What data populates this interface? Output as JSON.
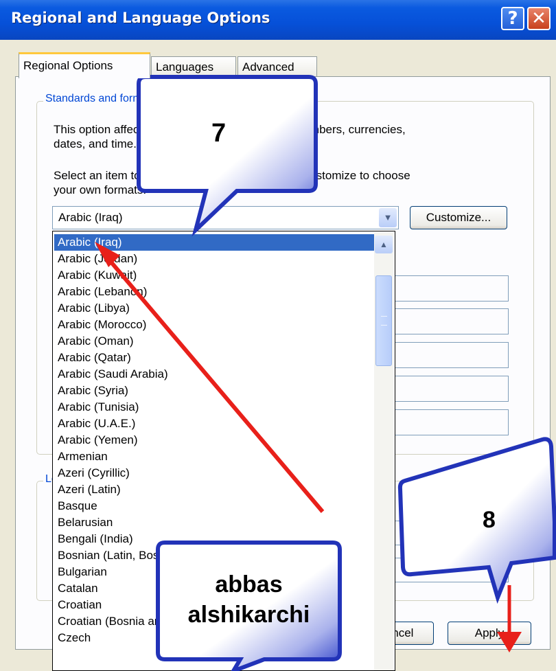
{
  "window": {
    "title": "Regional and Language Options",
    "help_label": "?",
    "close_label": "✕"
  },
  "tabs": [
    {
      "label": "Regional Options",
      "active": true
    },
    {
      "label": "Languages",
      "active": false
    },
    {
      "label": "Advanced",
      "active": false
    }
  ],
  "standards": {
    "group_label": "Standards and formats",
    "description": [
      "This option affects how some programs format numbers, currencies,",
      "dates, and time."
    ],
    "instruction": [
      "Select an item to match its preferences, or click Customize to choose",
      "your own formats:"
    ],
    "selected_value": "Arabic (Iraq)",
    "customize_label": "Customize..."
  },
  "location": {
    "group_label": "Location"
  },
  "dropdown": {
    "items": [
      "Arabic (Iraq)",
      "Arabic (Jordan)",
      "Arabic (Kuwait)",
      "Arabic (Lebanon)",
      "Arabic (Libya)",
      "Arabic (Morocco)",
      "Arabic (Oman)",
      "Arabic (Qatar)",
      "Arabic (Saudi Arabia)",
      "Arabic (Syria)",
      "Arabic (Tunisia)",
      "Arabic (U.A.E.)",
      "Arabic (Yemen)",
      "Armenian",
      "Azeri (Cyrillic)",
      "Azeri (Latin)",
      "Basque",
      "Belarusian",
      "Bengali (India)",
      "Bosnian (Latin, Bosnia and Herzegovina)",
      "Bulgarian",
      "Catalan",
      "Croatian",
      "Croatian (Bosnia and Herzegovina)",
      "Czech"
    ],
    "selected_index": 0
  },
  "buttons": {
    "cancel_label": "Cancel",
    "apply_label": "Apply"
  },
  "annotations": {
    "callout_7": "7",
    "callout_8": "8",
    "author_line1": "abbas",
    "author_line2": "alshikarchi"
  },
  "colors": {
    "titlebar": "#0a5ae0",
    "selection": "#316ac5",
    "group_label": "#0046d5",
    "callout_fill": "#2b3ec8",
    "arrow": "#e8201a"
  }
}
